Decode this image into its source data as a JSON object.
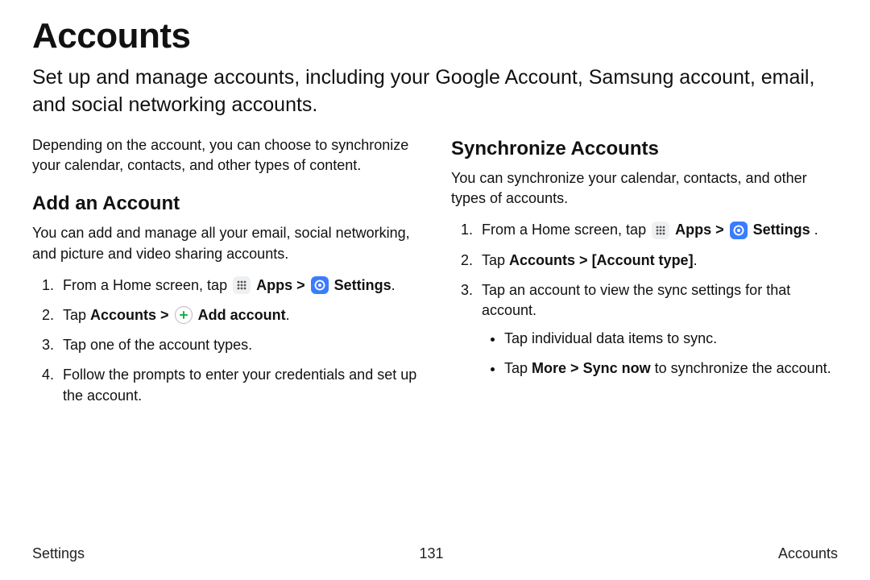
{
  "page": {
    "title": "Accounts",
    "intro": "Set up and manage accounts, including your Google Account, Samsung account, email, and social networking accounts."
  },
  "left": {
    "pre": "Depending on the account, you can choose to synchronize your calendar, contacts, and other types of content.",
    "heading": "Add an Account",
    "desc": "You can add and manage all your email, social networking, and picture and video sharing accounts.",
    "step1_pre": "From a Home screen, tap ",
    "step1_apps": "Apps",
    "step1_arrow": " > ",
    "step1_settings": "Settings",
    "step1_post": ".",
    "step2_pre": "Tap ",
    "step2_accounts": "Accounts",
    "step2_arrow": " > ",
    "step2_add": "Add account",
    "step2_post": ".",
    "step3": "Tap one of the account types.",
    "step4": "Follow the prompts to enter your credentials and set up the account."
  },
  "right": {
    "heading": "Synchronize Accounts",
    "desc": "You can synchronize your calendar, contacts, and other types of accounts.",
    "step1_pre": "From a Home screen, tap ",
    "step1_apps": "Apps",
    "step1_arrow": " > ",
    "step1_settings": "Settings",
    "step1_post": " .",
    "step2_pre": "Tap ",
    "step2_accounts": "Accounts",
    "step2_arrow": " > ",
    "step2_type": "[Account type]",
    "step2_post": ".",
    "step3": "Tap an account to view the sync settings for that account.",
    "sub1": "Tap individual data items to sync.",
    "sub2_pre": "Tap ",
    "sub2_more": "More",
    "sub2_arrow": " > ",
    "sub2_sync": "Sync now",
    "sub2_post": " to synchronize the account."
  },
  "footer": {
    "left": "Settings",
    "center": "131",
    "right": "Accounts"
  }
}
